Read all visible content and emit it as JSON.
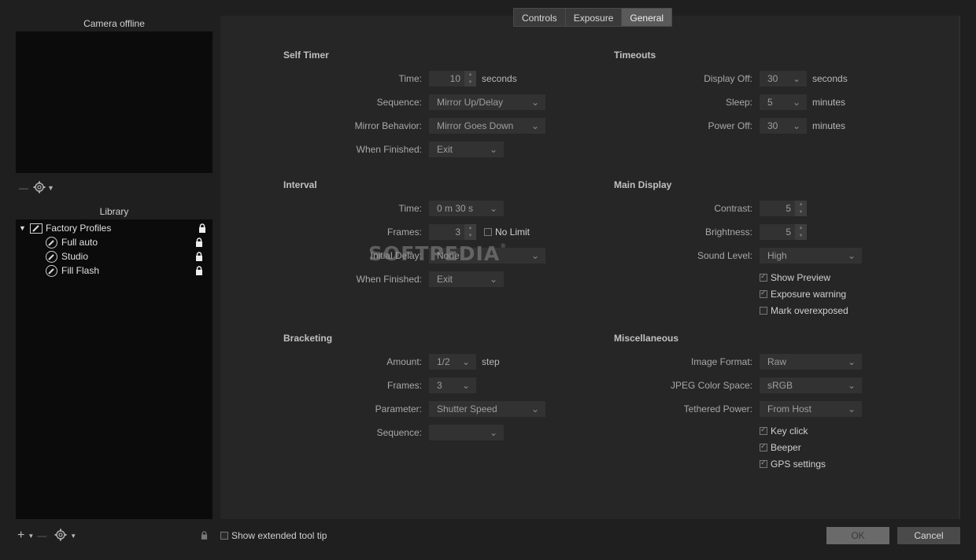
{
  "camera": {
    "title": "Camera offline"
  },
  "library": {
    "title": "Library",
    "root": "Factory Profiles",
    "items": [
      "Full auto",
      "Studio",
      "Fill Flash"
    ]
  },
  "tabs": [
    "Controls",
    "Exposure",
    "General"
  ],
  "active_tab": "General",
  "self_timer": {
    "title": "Self Timer",
    "time_label": "Time:",
    "time_value": "10",
    "time_unit": "seconds",
    "sequence_label": "Sequence:",
    "sequence_value": "Mirror Up/Delay",
    "mirror_label": "Mirror Behavior:",
    "mirror_value": "Mirror Goes Down",
    "finished_label": "When Finished:",
    "finished_value": "Exit"
  },
  "timeouts": {
    "title": "Timeouts",
    "display_label": "Display Off:",
    "display_value": "30",
    "display_unit": "seconds",
    "sleep_label": "Sleep:",
    "sleep_value": "5",
    "sleep_unit": "minutes",
    "power_label": "Power Off:",
    "power_value": "30",
    "power_unit": "minutes"
  },
  "interval": {
    "title": "Interval",
    "time_label": "Time:",
    "time_value": "0 m 30 s",
    "frames_label": "Frames:",
    "frames_value": "3",
    "no_limit_label": "No Limit",
    "delay_label": "Initial Delay:",
    "delay_value": "None",
    "finished_label": "When Finished:",
    "finished_value": "Exit"
  },
  "main_display": {
    "title": "Main Display",
    "contrast_label": "Contrast:",
    "contrast_value": "5",
    "brightness_label": "Brightness:",
    "brightness_value": "5",
    "sound_label": "Sound Level:",
    "sound_value": "High",
    "show_preview": "Show Preview",
    "exposure_warning": "Exposure warning",
    "mark_overexposed": "Mark overexposed"
  },
  "bracketing": {
    "title": "Bracketing",
    "amount_label": "Amount:",
    "amount_value": "1/2",
    "amount_unit": "step",
    "frames_label": "Frames:",
    "frames_value": "3",
    "parameter_label": "Parameter:",
    "parameter_value": "Shutter Speed",
    "sequence_label": "Sequence:",
    "sequence_value": ""
  },
  "misc": {
    "title": "Miscellaneous",
    "format_label": "Image Format:",
    "format_value": "Raw",
    "color_label": "JPEG Color Space:",
    "color_value": "sRGB",
    "power_label": "Tethered Power:",
    "power_value": "From Host",
    "key_click": "Key click",
    "beeper": "Beeper",
    "gps": "GPS settings"
  },
  "footer": {
    "tooltip_label": "Show extended tool tip",
    "ok": "OK",
    "cancel": "Cancel"
  },
  "watermark": "SOFTPEDIA",
  "icons": {
    "gear": "gear-icon",
    "lock": "lock-icon",
    "profile": "wrench-icon",
    "add": "plus-icon",
    "remove": "minus-icon",
    "expand": "triangle-down-icon"
  }
}
